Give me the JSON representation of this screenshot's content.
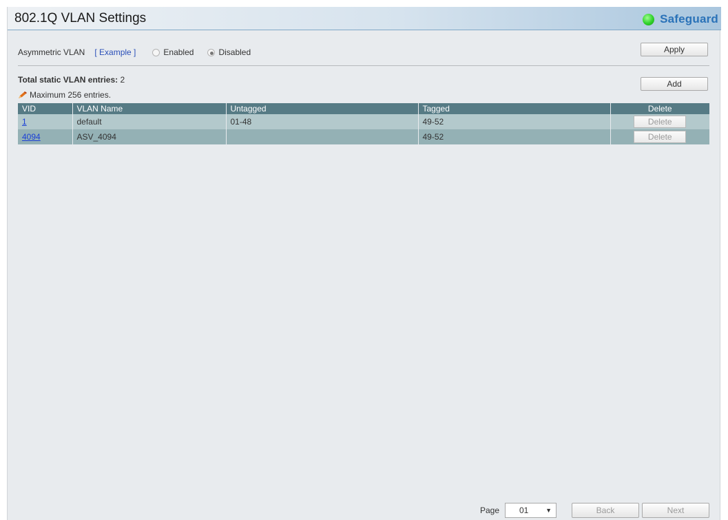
{
  "header": {
    "title": "802.1Q VLAN Settings",
    "status_label": "Safeguard",
    "status_color": "#2fd12a"
  },
  "asymmetric": {
    "label": "Asymmetric VLAN",
    "example_link": "[ Example ]",
    "enabled_label": "Enabled",
    "disabled_label": "Disabled",
    "selected": "Disabled",
    "apply_label": "Apply"
  },
  "entries": {
    "total_label": "Total static VLAN entries:",
    "total_value": "2",
    "max_note": "Maximum 256 entries.",
    "add_label": "Add"
  },
  "table": {
    "headers": [
      "VID",
      "VLAN Name",
      "Untagged",
      "Tagged",
      "Delete"
    ],
    "rows": [
      {
        "vid": "1",
        "name": "default",
        "untagged": "01-48",
        "tagged": "49-52",
        "delete": "Delete"
      },
      {
        "vid": "4094",
        "name": "ASV_4094",
        "untagged": "",
        "tagged": "49-52",
        "delete": "Delete"
      }
    ]
  },
  "pager": {
    "page_label": "Page",
    "page_value": "01",
    "back_label": "Back",
    "next_label": "Next"
  }
}
